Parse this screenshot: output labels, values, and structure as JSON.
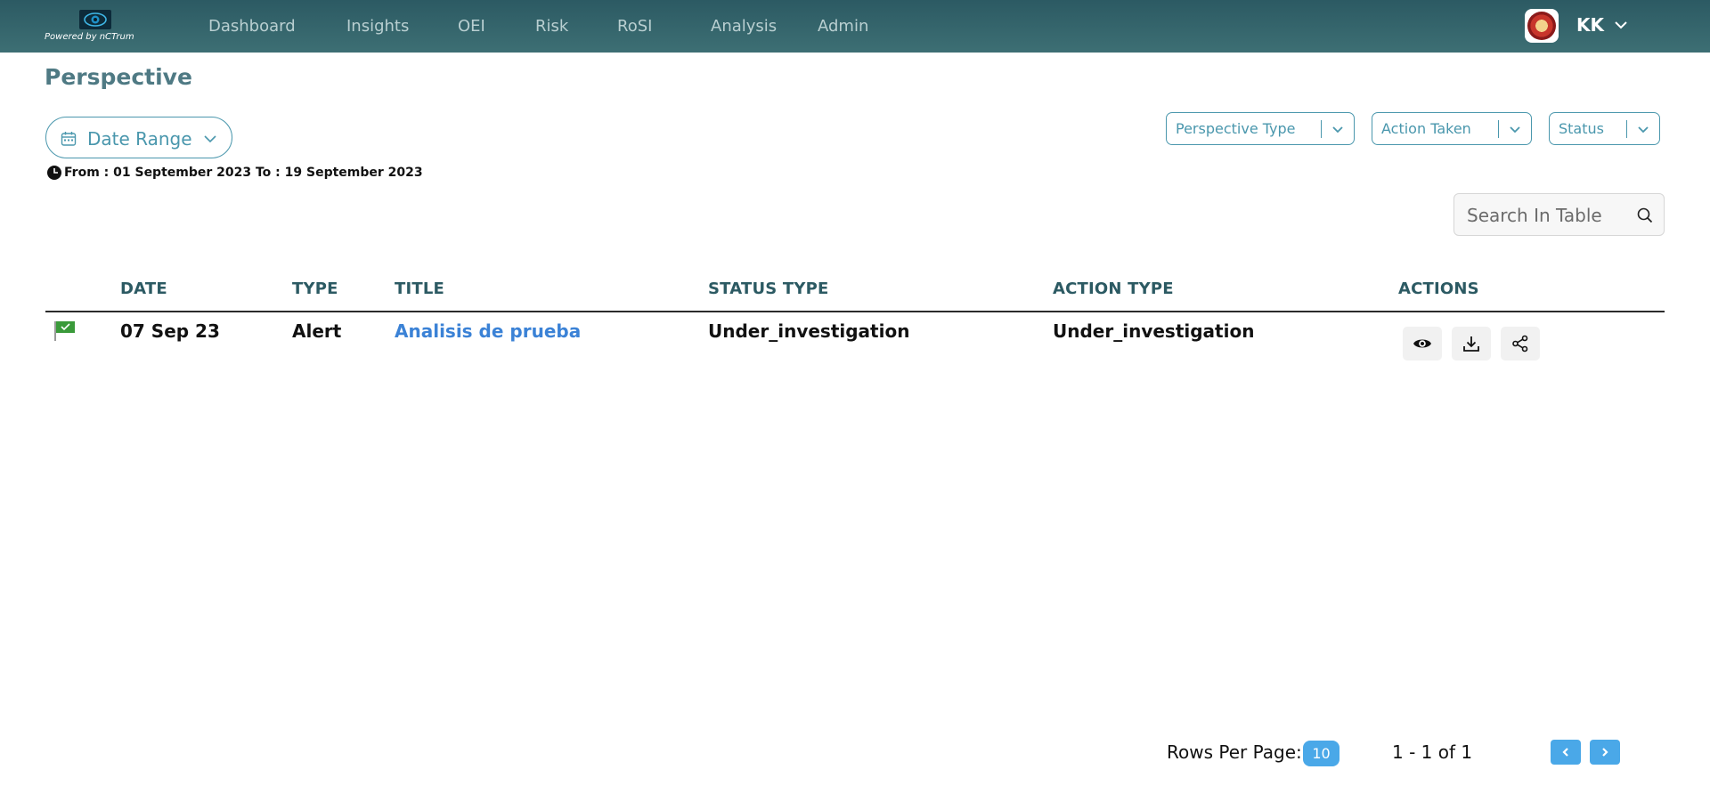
{
  "brand": {
    "powered_by": "Powered by nCTrum"
  },
  "nav": {
    "items": [
      {
        "label": "Dashboard"
      },
      {
        "label": "Insights"
      },
      {
        "label": "OEI"
      },
      {
        "label": "Risk"
      },
      {
        "label": "RoSI"
      },
      {
        "label": "Analysis"
      },
      {
        "label": "Admin"
      }
    ]
  },
  "user": {
    "initials": "KK"
  },
  "page": {
    "title": "Perspective"
  },
  "date_filter": {
    "label": "Date Range",
    "info": "From : 01 September 2023 To : 19 September 2023"
  },
  "filters": [
    {
      "label": "Perspective Type"
    },
    {
      "label": "Action Taken"
    },
    {
      "label": "Status"
    }
  ],
  "search": {
    "placeholder": "Search In Table"
  },
  "table": {
    "columns": [
      "DATE",
      "TYPE",
      "TITLE",
      "STATUS TYPE",
      "ACTION TYPE",
      "ACTIONS"
    ],
    "rows": [
      {
        "date": "07 Sep 23",
        "type": "Alert",
        "title": "Analisis de prueba",
        "status_type": "Under_investigation",
        "action_type": "Under_investigation",
        "actions": [
          "eye-icon",
          "download-icon",
          "share-icon"
        ]
      }
    ]
  },
  "pagination": {
    "rows_per_page_label": "Rows Per Page:",
    "rows_per_page": "10",
    "range": "1 - 1 of 1"
  },
  "colors": {
    "nav_bg": "#2c5a63",
    "accent": "#4a97ad",
    "header_text": "#2c5a63",
    "link": "#3b82d6",
    "button_blue": "#4aa8e8"
  }
}
